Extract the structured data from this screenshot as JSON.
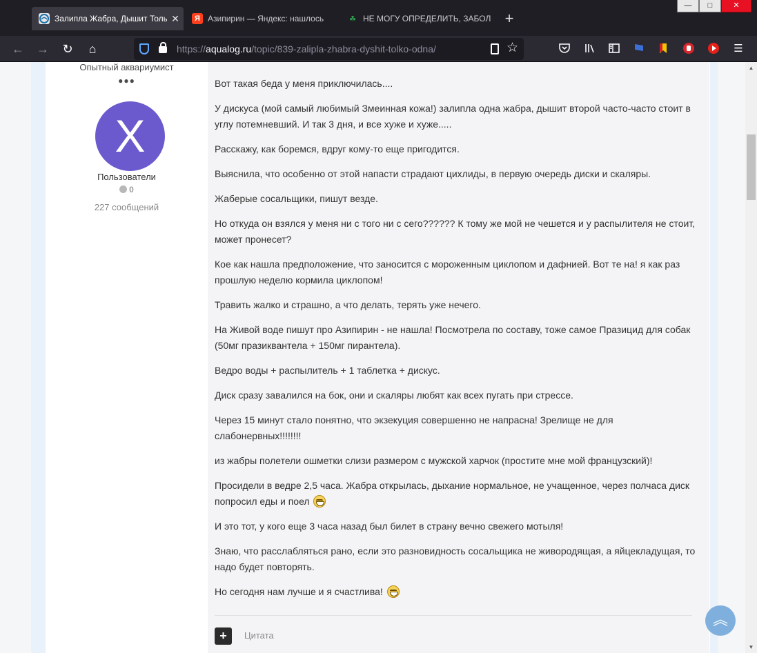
{
  "tabs": [
    {
      "title": "Залипла Жабра, Дышит Только",
      "favicon": "aqualog-icon",
      "active": true
    },
    {
      "title": "Азипирин — Яндекс: нашлось",
      "favicon": "yandex-icon",
      "active": false
    },
    {
      "title": "НЕ МОГУ ОПРЕДЕЛИТЬ, ЗАБОЛ",
      "favicon": "forum-icon",
      "active": false
    }
  ],
  "tab_favicon_glyphs": {
    "yandex": "Я",
    "forum": "☘"
  },
  "new_tab_label": "+",
  "window_controls": {
    "minimize": "—",
    "maximize": "□",
    "close": "✕"
  },
  "url": {
    "prefix": "https://",
    "domain": "aqualog.ru",
    "path": "/topic/839-zalipla-zhabra-dyshit-tolko-odna/"
  },
  "toolbar_icons": [
    "pocket-icon",
    "library-icon",
    "sidebar-icon",
    "flag-extension-icon",
    "bookmark-extension-icon",
    "hand-stop-extension-icon",
    "youtube-extension-icon",
    "menu-icon"
  ],
  "author": {
    "rank": "Опытный аквариумист",
    "avatar_letter": "X",
    "avatar_color": "#6a5acd",
    "group": "Пользователи",
    "reputation": "0",
    "posts_count": "227 сообщений"
  },
  "post": {
    "paragraphs": [
      "Вот такая беда у меня приключилась....",
      "У дискуса (мой самый любимый Змеинная кожа!) залипла одна жабра, дышит второй часто-часто стоит в углу потемневший. И так 3 дня, и все хуже и хуже.....",
      "Расскажу, как боремся, вдруг кому-то еще пригодится.",
      "Выяснила, что особенно от этой напасти страдают цихлиды, в первую очередь диски и скаляры.",
      "Жаберые сосальщики, пишут везде.",
      "Но откуда он взялся у меня ни с того ни с сего?????? К тому же мой не чешется и у распылителя не стоит, может пронесет?",
      "Кое как нашла предположение, что заносится с мороженным циклопом и дафнией. Вот те на! я как раз прошлую неделю кормила циклопом!",
      "Травить жалко и страшно, а что делать, терять уже нечего.",
      "На Живой воде пишут про Азипирин - не нашла! Посмотрела по составу, тоже самое Празицид для собак (50мг празиквантела + 150мг пирантела).",
      "Ведро воды + распылитель + 1 таблетка + дискус.",
      "Диск сразу завалился на бок, они и скаляры любят как всех пугать при стрессе.",
      "Через 15 минут стало понятно, что экзекуция совершенно не напрасна! Зрелище не для слабонервных!!!!!!!!",
      "из жабры полетели ошметки слизи размером с мужской харчок (простите мне мой французский)!",
      "Просидели в ведре 2,5 часа. Жабра открылась, дыхание нормальное, не учащенное, через полчаса диск попросил еды и поел",
      "И это тот, у кого еще 3 часа назад был билет в страну вечно свежего мотыля!",
      "Знаю, что расслабляться рано, если это разновидность сосальщика не живородящая, а яйцекладущая, то надо будет повторять.",
      "Но сегодня нам лучше и я счастлива!"
    ],
    "emoji_after_paragraphs": [
      13,
      16
    ],
    "emoji_name": "laughing-emoji-icon"
  },
  "actions": {
    "multiquote_label": "+",
    "quote_label": "Цитата"
  },
  "scroll_to_top_label": "︽",
  "colors": {
    "accent": "#7fb0dd",
    "content_bg": "#f4f4f6",
    "page_bg": "#e9f1fa"
  }
}
